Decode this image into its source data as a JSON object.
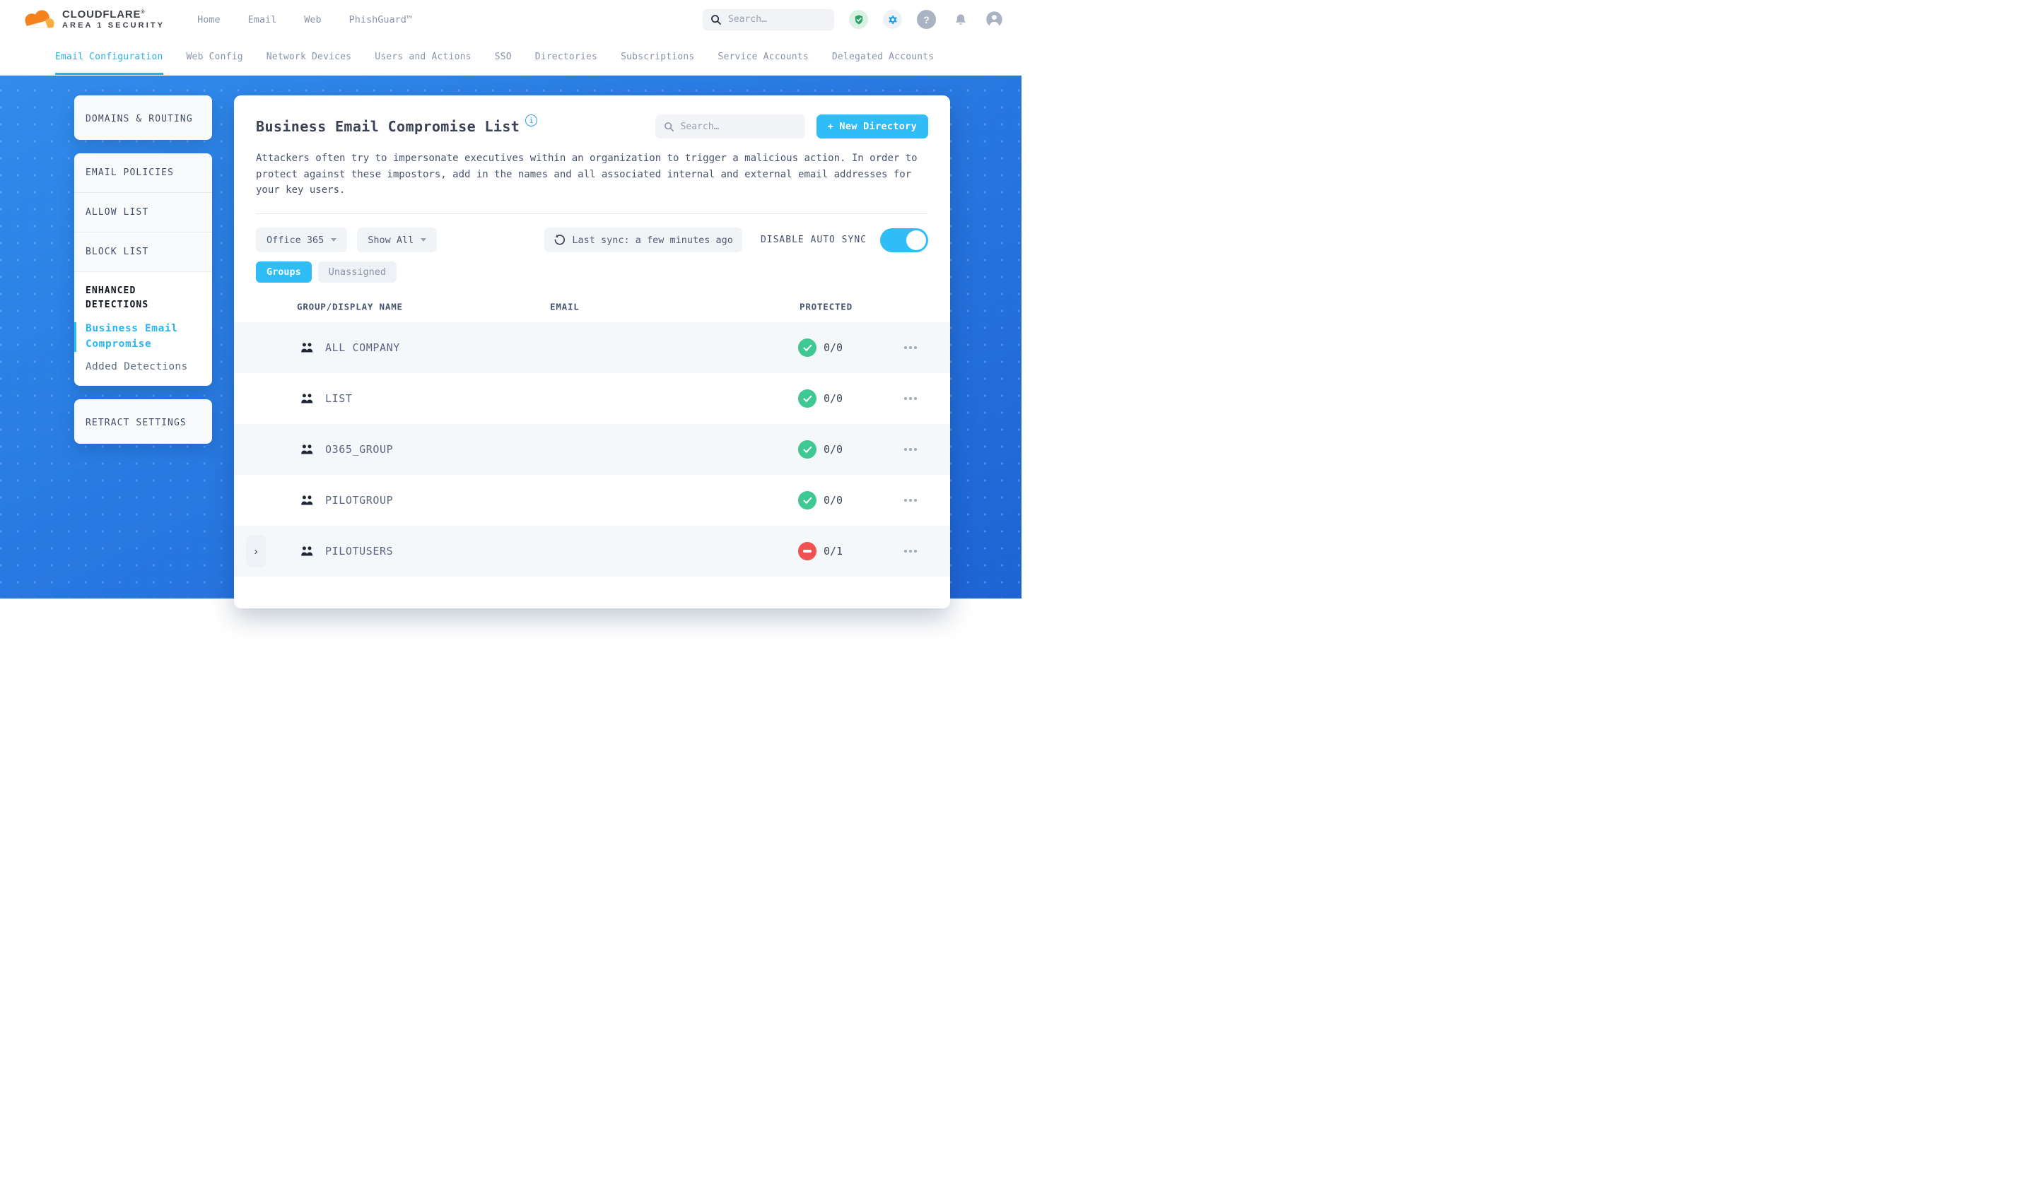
{
  "brand": {
    "title": "CLOUDFLARE",
    "registered": "®",
    "subtitle": "AREA 1 SECURITY"
  },
  "topnav": {
    "items": [
      {
        "label": "Home"
      },
      {
        "label": "Email"
      },
      {
        "label": "Web"
      },
      {
        "label": "PhishGuard™"
      }
    ],
    "search_placeholder": "Search…"
  },
  "tabs": {
    "items": [
      {
        "label": "Email Configuration",
        "active": true
      },
      {
        "label": "Web Config"
      },
      {
        "label": "Network Devices"
      },
      {
        "label": "Users and Actions"
      },
      {
        "label": "SSO"
      },
      {
        "label": "Directories"
      },
      {
        "label": "Subscriptions"
      },
      {
        "label": "Service Accounts"
      },
      {
        "label": "Delegated Accounts"
      }
    ]
  },
  "sidebar": {
    "domains_routing": "DOMAINS & ROUTING",
    "email_policies": "EMAIL POLICIES",
    "allow_list": "ALLOW LIST",
    "block_list": "BLOCK LIST",
    "enhanced_detections": "ENHANCED DETECTIONS",
    "business_email_compromise": "Business Email Compromise",
    "added_detections": "Added Detections",
    "retract_settings": "RETRACT SETTINGS"
  },
  "main": {
    "title": "Business Email Compromise List",
    "info_icon": "i",
    "search_placeholder": "Search…",
    "new_directory_button": "+ New Directory",
    "description": "Attackers often try to impersonate executives within an organization to trigger a malicious action. In order to protect against these impostors, add in the names and all associated internal and external email addresses for your key users.",
    "filters": {
      "directory_select": "Office 365",
      "view_select": "Show All",
      "last_sync": "Last sync: a few minutes ago",
      "auto_sync_label": "DISABLE AUTO SYNC",
      "auto_sync_on": true
    },
    "view_pills": {
      "groups": "Groups",
      "unassigned": "Unassigned"
    },
    "table": {
      "headers": [
        "GROUP/DISPLAY NAME",
        "EMAIL",
        "PROTECTED"
      ],
      "rows": [
        {
          "name": "ALL COMPANY",
          "email": "",
          "protected": "0/0",
          "status": "protected",
          "expandable": false
        },
        {
          "name": "LIST",
          "email": "",
          "protected": "0/0",
          "status": "protected",
          "expandable": false
        },
        {
          "name": "O365_GROUP",
          "email": "",
          "protected": "0/0",
          "status": "protected",
          "expandable": false
        },
        {
          "name": "PILOTGROUP",
          "email": "",
          "protected": "0/0",
          "status": "protected",
          "expandable": false
        },
        {
          "name": "PILOTUSERS",
          "email": "",
          "protected": "0/1",
          "status": "unprotected",
          "expandable": true
        }
      ]
    }
  },
  "colors": {
    "accent": "#29b2ea",
    "accent_bright": "#2ebdf6",
    "green": "#3fc794",
    "red": "#f05252",
    "background_blue": "#2777e0",
    "logo_orange": "#f6821f",
    "logo_light_orange": "#fbad41"
  }
}
